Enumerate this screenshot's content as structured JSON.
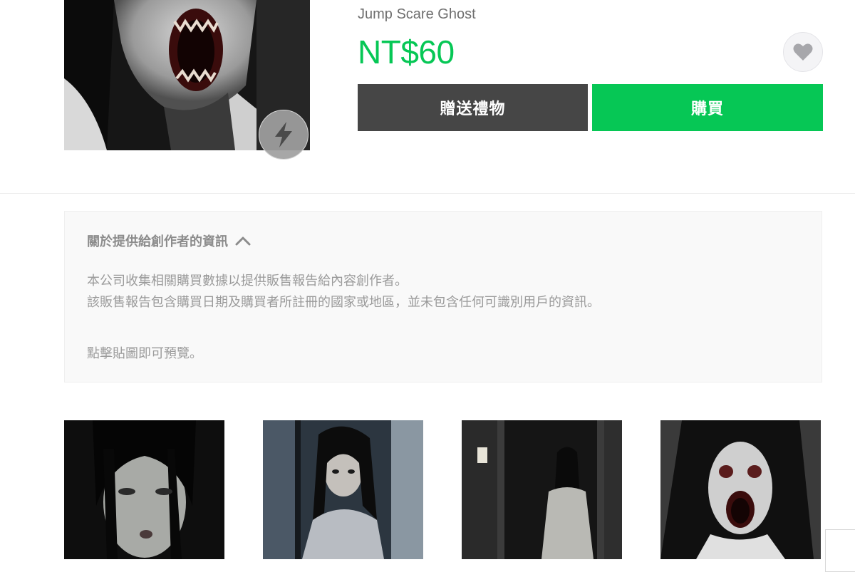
{
  "product": {
    "title": "Jump Scare Ghost",
    "price": "NT$60",
    "price_color": "#06c755",
    "main_image": "screaming-ghost-sticker",
    "effect_icon": "lightning-bolt-icon",
    "favorite_icon": "heart-icon"
  },
  "actions": {
    "gift_label": "贈送禮物",
    "buy_label": "購買",
    "gift_color": "#464646",
    "buy_color": "#06c755"
  },
  "info": {
    "heading": "關於提供給創作者的資訊",
    "toggle_icon": "chevron-up-icon",
    "line1": "本公司收集相關購買數據以提供販售報告給內容創作者。",
    "line2": "該販售報告包含購買日期及購買者所註冊的國家或地區，並未包含任何可識別用戶的資訊。",
    "line3": "點擊貼圖即可預覽。"
  },
  "stickers": [
    {
      "name": "ghost-girl-face"
    },
    {
      "name": "ghost-behind-curtain"
    },
    {
      "name": "ghost-in-doorway"
    },
    {
      "name": "screaming-ghost"
    }
  ]
}
